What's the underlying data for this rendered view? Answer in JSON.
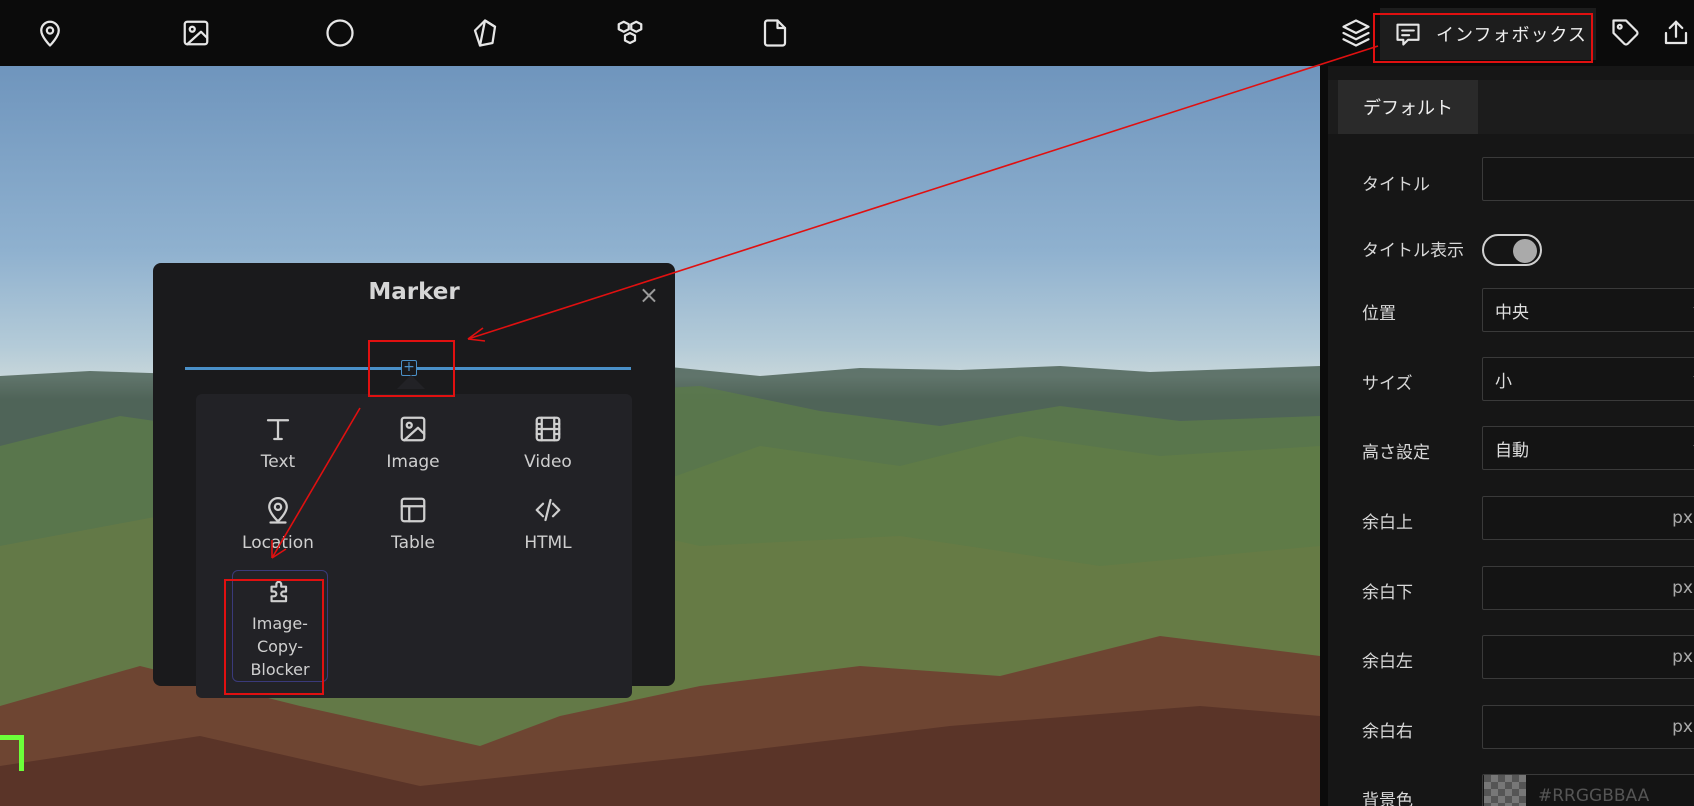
{
  "toolbar": {
    "icons": [
      "pin-icon",
      "image-icon",
      "circle-icon",
      "polygon-icon",
      "model-icon",
      "file-icon",
      "layers-icon",
      "infobox-icon",
      "tag-icon",
      "export-icon"
    ],
    "infobox_label": "インフォボックス"
  },
  "panel": {
    "tab": "デフォルト",
    "title_label": "タイトル",
    "title_display_label": "タイトル表示",
    "position_label": "位置",
    "position_value": "中央",
    "size_label": "サイズ",
    "size_value": "小",
    "height_label": "高さ設定",
    "height_value": "自動",
    "margin_top_label": "余白上",
    "margin_bottom_label": "余白下",
    "margin_left_label": "余白左",
    "margin_right_label": "余白右",
    "unit": "px",
    "bg_color_label": "背景色",
    "bg_color_placeholder": "#RRGGBBAA"
  },
  "dialog": {
    "title": "Marker",
    "close": "×",
    "add": "+",
    "items": {
      "text": "Text",
      "image": "Image",
      "video": "Video",
      "location": "Location",
      "table": "Table",
      "html": "HTML",
      "plugin": "Image-\nCopy-\nBlocker"
    }
  },
  "colors": {
    "accent": "#4a90c8",
    "annotation": "#e01010",
    "marker": "#6cff3a"
  }
}
